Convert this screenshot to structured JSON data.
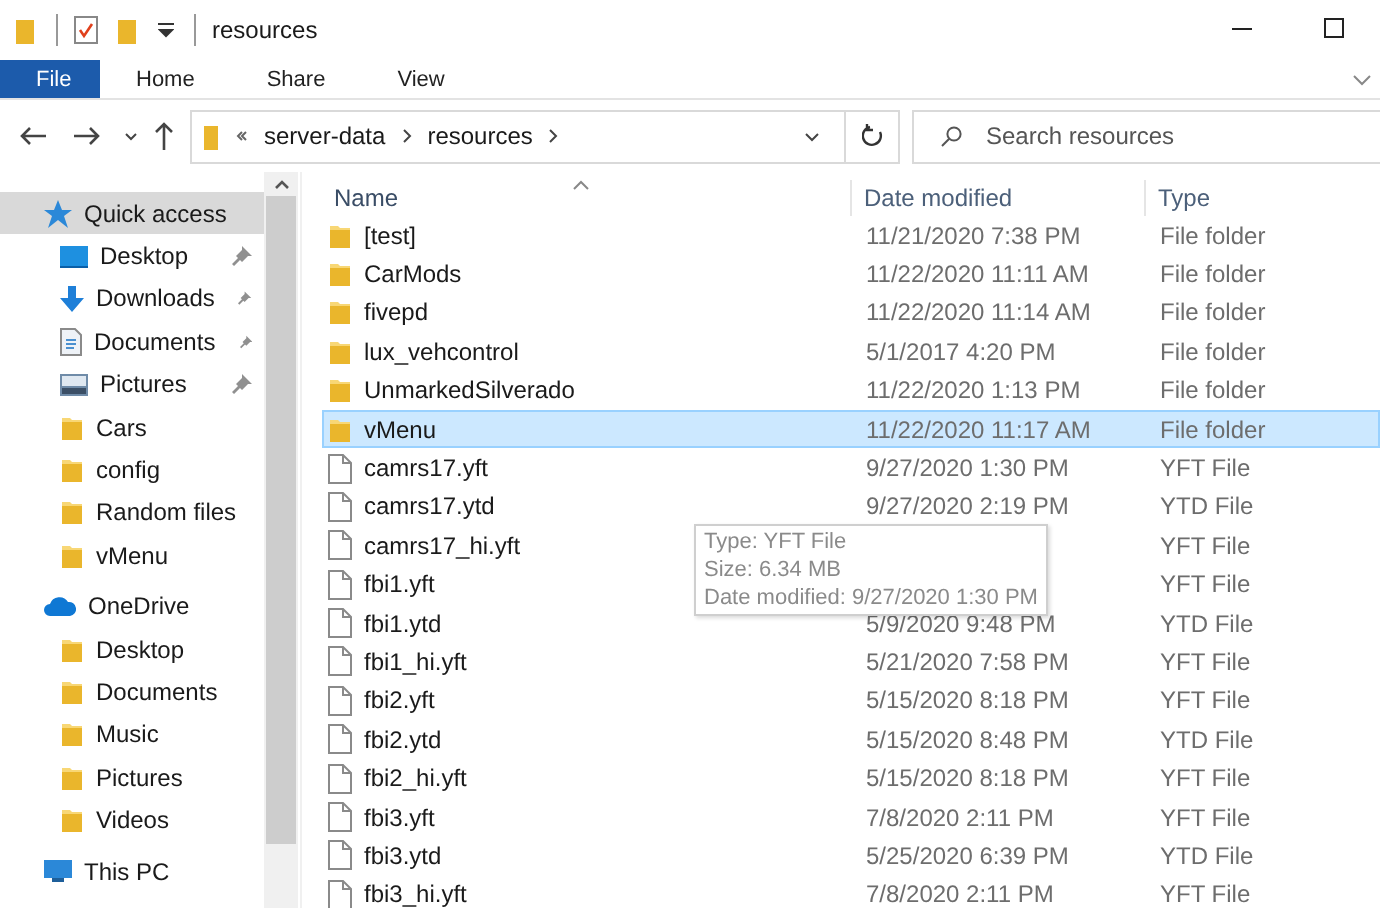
{
  "title_bar": {
    "title": "resources"
  },
  "ribbon": {
    "tabs": [
      {
        "label": "File",
        "kind": "file"
      },
      {
        "label": "Home",
        "kind": "tab"
      },
      {
        "label": "Share",
        "kind": "tab"
      },
      {
        "label": "View",
        "kind": "tab"
      }
    ]
  },
  "address_bar": {
    "path": [
      "server-data",
      "resources"
    ]
  },
  "search": {
    "placeholder": "Search resources"
  },
  "sidebar": {
    "items": [
      {
        "label": "Quick access",
        "kind": "star",
        "selected": true,
        "children": [
          {
            "label": "Desktop",
            "kind": "desktop",
            "pinned": true,
            "selected": false
          },
          {
            "label": "Downloads",
            "kind": "downloads",
            "pinned": true,
            "selected": false
          },
          {
            "label": "Documents",
            "kind": "documents",
            "pinned": true,
            "selected": false
          },
          {
            "label": "Pictures",
            "kind": "pictures",
            "pinned": true,
            "selected": false
          },
          {
            "label": "Cars",
            "kind": "folder",
            "pinned": false,
            "selected": false
          },
          {
            "label": "config",
            "kind": "folder",
            "pinned": false,
            "selected": false
          },
          {
            "label": "Random files",
            "kind": "folder",
            "pinned": false,
            "selected": false
          },
          {
            "label": "vMenu",
            "kind": "folder",
            "pinned": false,
            "selected": false
          }
        ]
      },
      {
        "label": "OneDrive",
        "kind": "cloud",
        "selected": false,
        "children": [
          {
            "label": "Desktop",
            "kind": "folder",
            "pinned": false,
            "selected": false
          },
          {
            "label": "Documents",
            "kind": "folder",
            "pinned": false,
            "selected": false
          },
          {
            "label": "Music",
            "kind": "folder",
            "pinned": false,
            "selected": false
          },
          {
            "label": "Pictures",
            "kind": "folder",
            "pinned": false,
            "selected": false
          },
          {
            "label": "Videos",
            "kind": "folder",
            "pinned": false,
            "selected": false
          }
        ]
      },
      {
        "label": "This PC",
        "kind": "pc",
        "selected": false
      }
    ]
  },
  "table": {
    "columns": [
      {
        "label": "Name",
        "sorted": true
      },
      {
        "label": "Date modified",
        "sorted": false
      },
      {
        "label": "Type",
        "sorted": false
      }
    ],
    "rows": [
      {
        "name": "[test]",
        "date": "11/21/2020 7:38 PM",
        "type": "File folder",
        "kind": "folder",
        "selected": false
      },
      {
        "name": "CarMods",
        "date": "11/22/2020 11:11 AM",
        "type": "File folder",
        "kind": "folder",
        "selected": false
      },
      {
        "name": "fivepd",
        "date": "11/22/2020 11:14 AM",
        "type": "File folder",
        "kind": "folder",
        "selected": false
      },
      {
        "name": "lux_vehcontrol",
        "date": "5/1/2017 4:20 PM",
        "type": "File folder",
        "kind": "folder",
        "selected": false
      },
      {
        "name": "UnmarkedSilverado",
        "date": "11/22/2020 1:13 PM",
        "type": "File folder",
        "kind": "folder",
        "selected": false
      },
      {
        "name": "vMenu",
        "date": "11/22/2020 11:17 AM",
        "type": "File folder",
        "kind": "folder",
        "selected": true
      },
      {
        "name": "camrs17.yft",
        "date": "9/27/2020 1:30 PM",
        "type": "YFT File",
        "kind": "file",
        "selected": false
      },
      {
        "name": "camrs17.ytd",
        "date": "9/27/2020 2:19 PM",
        "type": "YTD File",
        "kind": "file",
        "selected": false
      },
      {
        "name": "camrs17_hi.yft",
        "type": "YFT File",
        "kind": "file",
        "selected": false
      },
      {
        "name": "fbi1.yft",
        "type": "YFT File",
        "kind": "file",
        "selected": false
      },
      {
        "name": "fbi1.ytd",
        "date": "5/9/2020 9:48 PM",
        "type": "YTD File",
        "kind": "file",
        "selected": false
      },
      {
        "name": "fbi1_hi.yft",
        "date": "5/21/2020 7:58 PM",
        "type": "YFT File",
        "kind": "file",
        "selected": false
      },
      {
        "name": "fbi2.yft",
        "date": "5/15/2020 8:18 PM",
        "type": "YFT File",
        "kind": "file",
        "selected": false
      },
      {
        "name": "fbi2.ytd",
        "date": "5/15/2020 8:48 PM",
        "type": "YTD File",
        "kind": "file",
        "selected": false
      },
      {
        "name": "fbi2_hi.yft",
        "date": "5/15/2020 8:18 PM",
        "type": "YFT File",
        "kind": "file",
        "selected": false
      },
      {
        "name": "fbi3.yft",
        "date": "7/8/2020 2:11 PM",
        "type": "YFT File",
        "kind": "file",
        "selected": false
      },
      {
        "name": "fbi3.ytd",
        "date": "5/25/2020 6:39 PM",
        "type": "YTD File",
        "kind": "file",
        "selected": false
      },
      {
        "name": "fbi3_hi.yft",
        "date": "7/8/2020 2:11 PM",
        "type": "YFT File",
        "kind": "file",
        "selected": false
      }
    ]
  },
  "tooltip": {
    "lines": [
      "Type: YFT File",
      "Size: 6.34 MB",
      "Date modified: 9/27/2020 1:30 PM"
    ]
  }
}
